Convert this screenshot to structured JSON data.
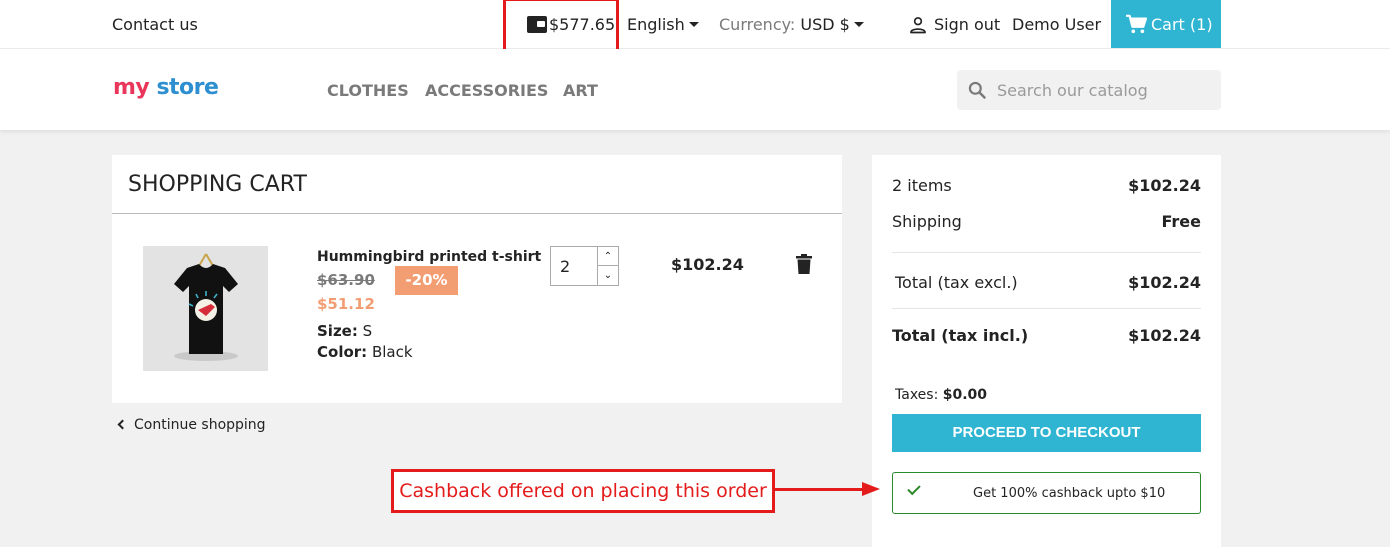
{
  "topbar": {
    "contact": "Contact us",
    "wallet_balance": "$577.65",
    "language": "English",
    "currency_label": "Currency:",
    "currency_value": "USD $",
    "sign_out": "Sign out",
    "user_name": "Demo User",
    "cart_label": "Cart (1)"
  },
  "header": {
    "logo": {
      "part1": "my",
      "part2": "store"
    },
    "nav": [
      "CLOTHES",
      "ACCESSORIES",
      "ART"
    ],
    "search_placeholder": "Search our catalog"
  },
  "cart": {
    "title": "SHOPPING CART",
    "item": {
      "name": "Hummingbird printed t-shirt",
      "old_price": "$63.90",
      "discount": "-20%",
      "new_price": "$51.12",
      "size_label": "Size:",
      "size_value": "S",
      "color_label": "Color:",
      "color_value": "Black",
      "quantity": "2",
      "line_total": "$102.24"
    },
    "continue_shopping": "Continue shopping"
  },
  "summary": {
    "items_label": "2 items",
    "items_value": "$102.24",
    "shipping_label": "Shipping",
    "shipping_value": "Free",
    "total_excl_label": "Total (tax excl.)",
    "total_excl_value": "$102.24",
    "total_incl_label": "Total (tax incl.)",
    "total_incl_value": "$102.24",
    "taxes_label": "Taxes:",
    "taxes_value": "$0.00",
    "checkout_button": "PROCEED TO CHECKOUT",
    "cashback_text": "Get 100% cashback upto $10"
  },
  "annotation": {
    "text": "Cashback offered on placing this order"
  },
  "colors": {
    "accent": "#2fb5d2",
    "discount": "#f39d72",
    "annotation": "#e31b1b",
    "cashback_border": "#2c8a2c"
  }
}
